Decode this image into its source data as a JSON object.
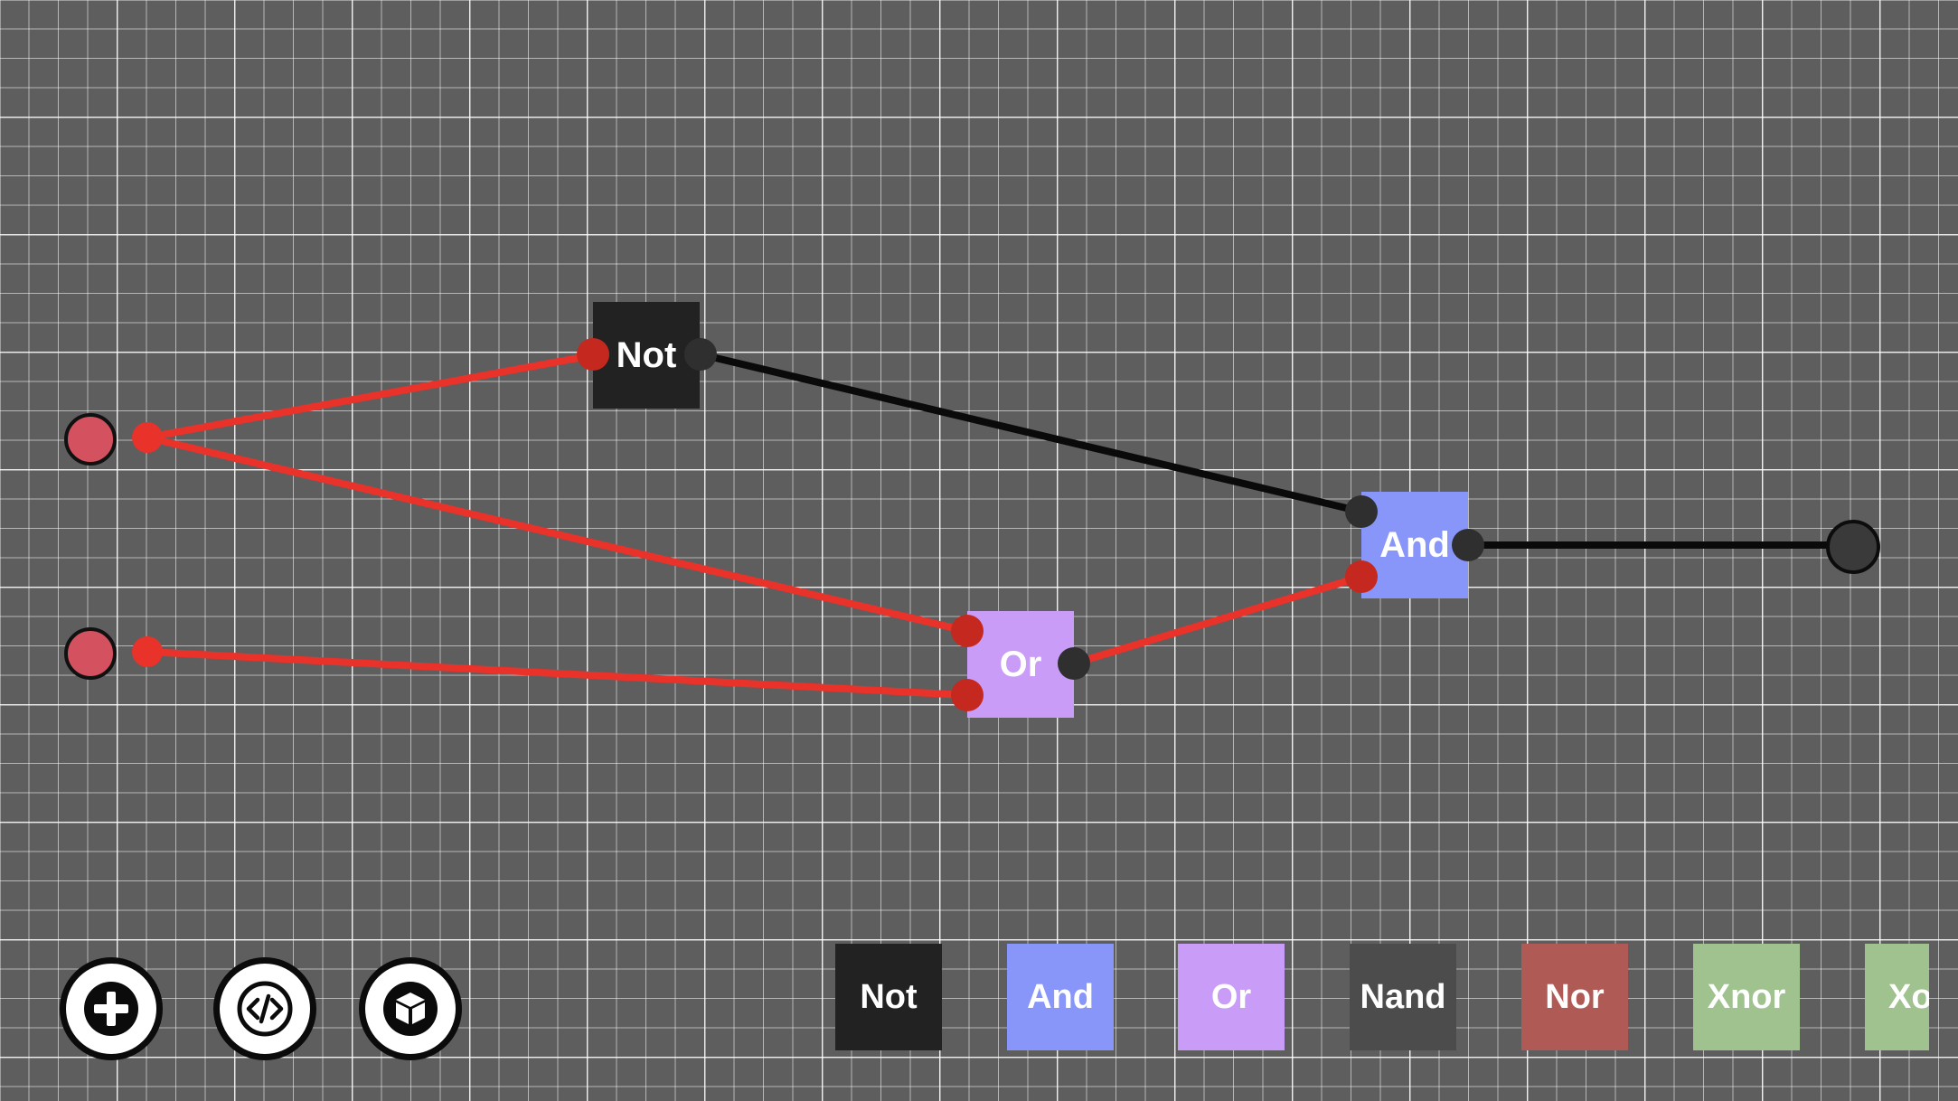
{
  "colors": {
    "background": "#5e5e5e",
    "grid": "#ffffff",
    "wire_active": "#e8322a",
    "wire_inactive": "#0a0a0a",
    "input_on": "#d4525f",
    "pin_red": "#c4281e",
    "pin_dark": "#2f2f2f"
  },
  "circuit": {
    "gates": [
      {
        "label": "Not",
        "color": "#222222"
      },
      {
        "label": "Or",
        "color": "#c89cf7"
      },
      {
        "label": "And",
        "color": "#8896f9"
      }
    ],
    "inputs": [
      {
        "state": "on"
      },
      {
        "state": "on"
      }
    ],
    "output": {
      "state": "off"
    }
  },
  "toolbar": [
    {
      "icon": "plus-icon"
    },
    {
      "icon": "code-icon"
    },
    {
      "icon": "cube-icon"
    }
  ],
  "palette": [
    {
      "label": "Not",
      "color": "#222222"
    },
    {
      "label": "And",
      "color": "#8896f9"
    },
    {
      "label": "Or",
      "color": "#c89cf7"
    },
    {
      "label": "Nand",
      "color": "#4d4c4c"
    },
    {
      "label": "Nor",
      "color": "#b05a55"
    },
    {
      "label": "Xnor",
      "color": "#9fc28e"
    },
    {
      "label": "Xor",
      "color": "#9fc28e"
    }
  ]
}
